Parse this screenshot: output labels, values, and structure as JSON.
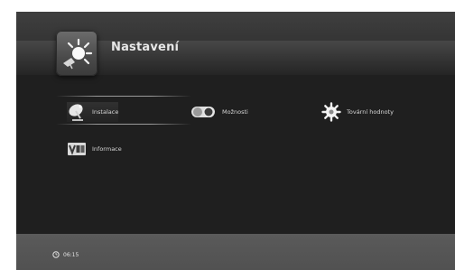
{
  "header": {
    "title": "Nastavení",
    "icon": "settings-sun-icon"
  },
  "menu": {
    "items": [
      {
        "label": "Instalace",
        "icon": "satellite-dish-icon",
        "selected": true
      },
      {
        "label": "Možnosti",
        "icon": "toggle-options-icon",
        "selected": false
      },
      {
        "label": "Tovární hodnoty",
        "icon": "gear-sun-icon",
        "selected": false
      },
      {
        "label": "Informace",
        "icon": "version-icon",
        "selected": false
      }
    ]
  },
  "footer": {
    "clock_icon": "clock-icon",
    "time": "06:15"
  },
  "colors": {
    "background": "#1f1f1f",
    "header": "#3a3a3a",
    "footer": "#555555",
    "text": "#d6d6d6"
  }
}
